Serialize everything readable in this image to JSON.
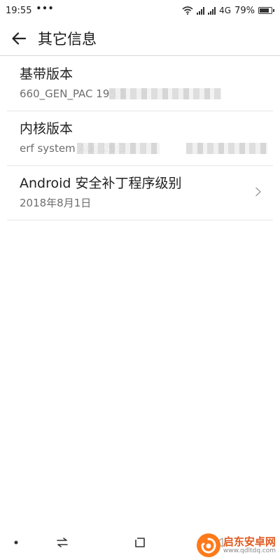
{
  "status_bar": {
    "time": "19:55",
    "dots": "•••",
    "network": "4G",
    "battery_percent": "79%",
    "battery_level": 0.79
  },
  "app_bar": {
    "title": "其它信息",
    "back_icon": "arrow-left-icon"
  },
  "items": [
    {
      "title": "基带版本",
      "value": "660_GEN_PAC              195.1",
      "has_chevron": false
    },
    {
      "title": "内核版本",
      "value": "erf system               Aug       26:3",
      "has_chevron": false
    },
    {
      "title": "Android 安全补丁程序级别",
      "value": "2018年8月1日",
      "has_chevron": true
    }
  ],
  "nav_bar": {
    "dot_icon": "dot-icon",
    "switch_icon": "swap-arrows-icon",
    "home_icon": "square-icon",
    "back_icon": "back-triangle-icon"
  },
  "watermark": {
    "name": "启东安卓网",
    "url": "www.qdltdq.com",
    "color": "#e05a1e"
  }
}
